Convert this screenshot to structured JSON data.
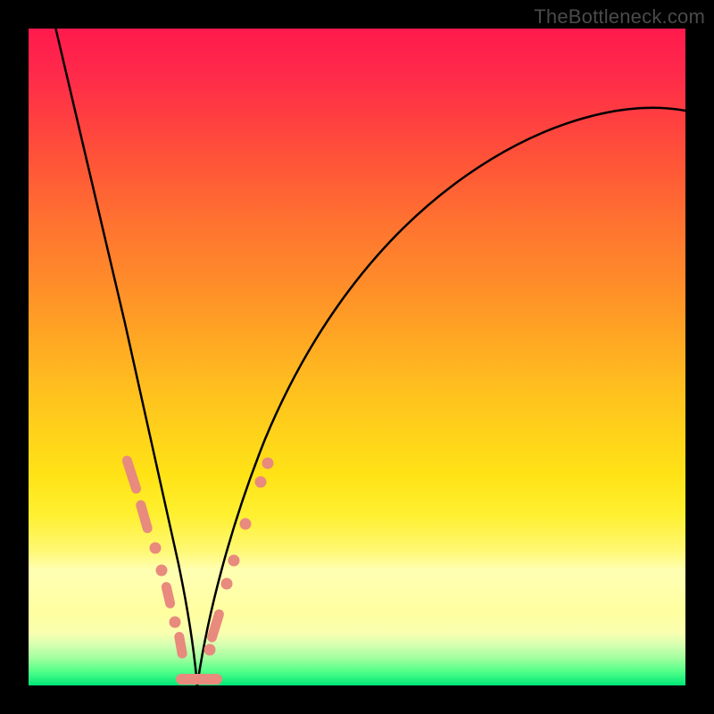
{
  "watermark": "TheBottleneck.com",
  "colors": {
    "frame": "#000000",
    "curve": "#000000",
    "marker": "#e88a7d",
    "gradient_top": "#ff1a4d",
    "gradient_bottom": "#00e676"
  },
  "chart_data": {
    "type": "line",
    "title": "",
    "xlabel": "",
    "ylabel": "",
    "xlim": [
      0,
      100
    ],
    "ylim": [
      0,
      100
    ],
    "grid": false,
    "legend": false,
    "note": "Axes unlabeled; values are relative percentages estimated from pixel positions. y=0 at bottom (green), y=100 at top (red). Two curves form a V with minimum near x≈25.",
    "series": [
      {
        "name": "left-branch",
        "x": [
          4,
          6,
          8,
          10,
          12,
          14,
          16,
          18,
          20,
          22,
          24,
          25.5
        ],
        "y": [
          100,
          90,
          79,
          68,
          57,
          47,
          38,
          30,
          22,
          14,
          6,
          0
        ]
      },
      {
        "name": "right-branch",
        "x": [
          25.5,
          28,
          31,
          34,
          38,
          43,
          49,
          56,
          64,
          73,
          83,
          94,
          100
        ],
        "y": [
          0,
          8,
          18,
          27,
          36,
          45,
          54,
          62,
          69,
          75,
          80,
          84,
          86
        ]
      }
    ],
    "markers": {
      "note": "Salmon dots/pills clustered near the valley on both branches, roughly y in [0,35].",
      "points": [
        {
          "branch": "left",
          "x": 15.5,
          "y": 34,
          "shape": "pill",
          "len": 6
        },
        {
          "branch": "left",
          "x": 17.5,
          "y": 27,
          "shape": "pill",
          "len": 5
        },
        {
          "branch": "left",
          "x": 19.5,
          "y": 20,
          "shape": "dot"
        },
        {
          "branch": "left",
          "x": 20.5,
          "y": 16,
          "shape": "dot"
        },
        {
          "branch": "left",
          "x": 21.5,
          "y": 12,
          "shape": "pill",
          "len": 4
        },
        {
          "branch": "left",
          "x": 22.5,
          "y": 8,
          "shape": "dot"
        },
        {
          "branch": "left",
          "x": 23.5,
          "y": 5,
          "shape": "pill",
          "len": 4
        },
        {
          "branch": "valley",
          "x": 25.0,
          "y": 0.5,
          "shape": "pill",
          "len": 7,
          "horizontal": true
        },
        {
          "branch": "right",
          "x": 27.5,
          "y": 5,
          "shape": "dot"
        },
        {
          "branch": "right",
          "x": 28.5,
          "y": 9,
          "shape": "pill",
          "len": 5
        },
        {
          "branch": "right",
          "x": 30.0,
          "y": 15,
          "shape": "dot"
        },
        {
          "branch": "right",
          "x": 31.0,
          "y": 19,
          "shape": "dot"
        },
        {
          "branch": "right",
          "x": 32.5,
          "y": 24,
          "shape": "dot"
        },
        {
          "branch": "right",
          "x": 35.0,
          "y": 31,
          "shape": "dot"
        },
        {
          "branch": "right",
          "x": 36.0,
          "y": 34,
          "shape": "dot"
        }
      ]
    }
  }
}
